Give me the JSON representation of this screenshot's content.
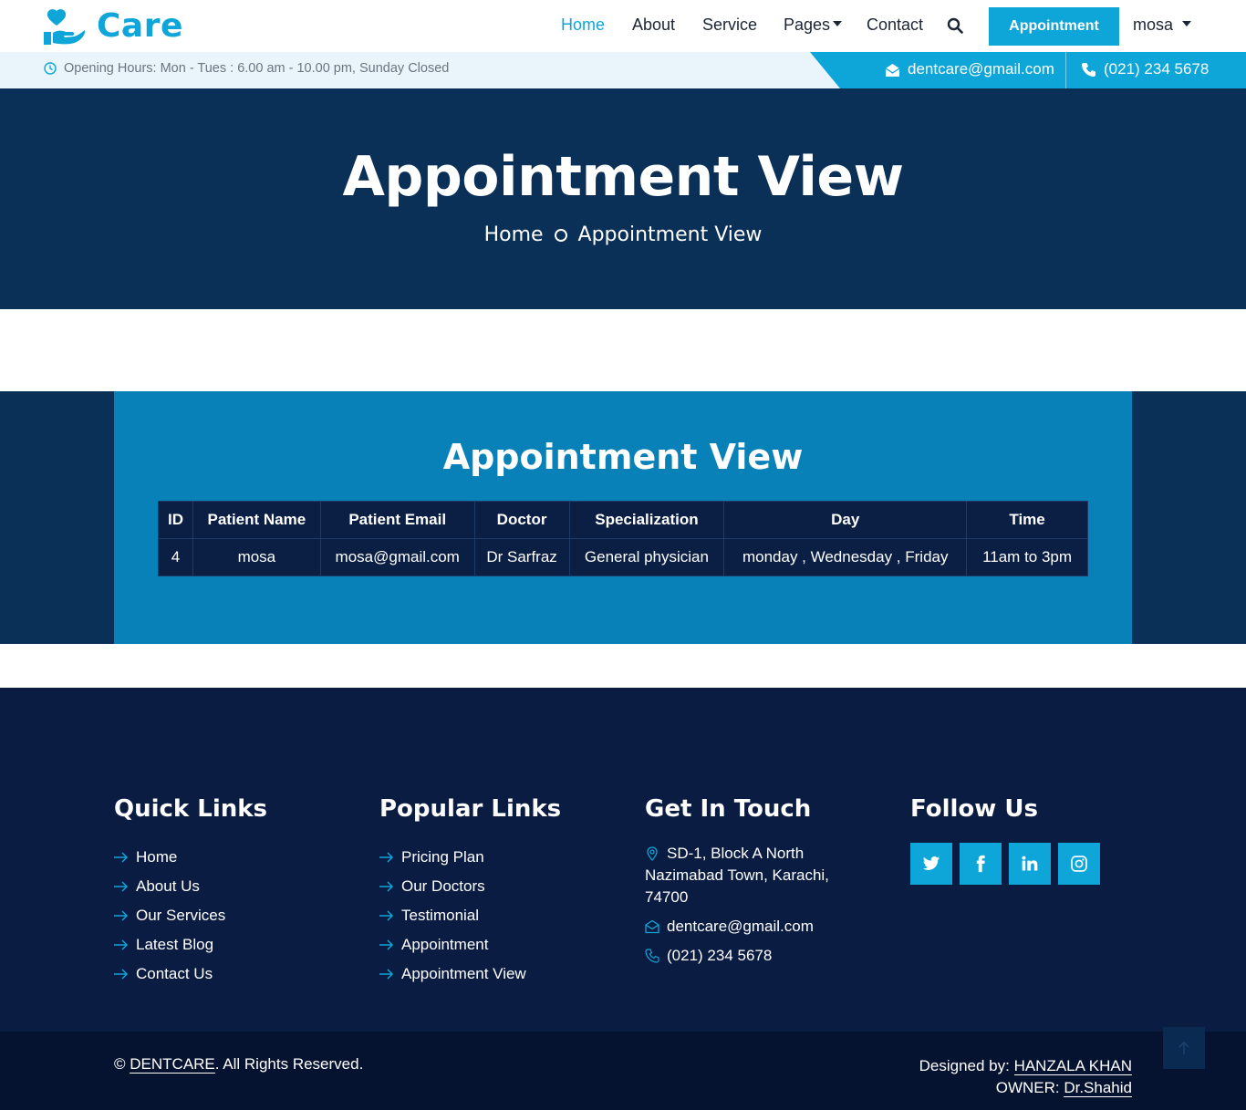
{
  "brand": {
    "name": "Care",
    "color": "#0ea5d9"
  },
  "nav": {
    "items": [
      {
        "label": "Home",
        "active": true
      },
      {
        "label": "About"
      },
      {
        "label": "Service"
      },
      {
        "label": "Pages",
        "dropdown": true
      },
      {
        "label": "Contact"
      }
    ],
    "search_icon": "search-icon",
    "appointment_button": "Appointment",
    "user": "mosa"
  },
  "topbar": {
    "hours": "Opening Hours: Mon - Tues : 6.00 am - 10.00 pm, Sunday Closed",
    "email": "dentcare@gmail.com",
    "phone": "(021) 234 5678"
  },
  "hero": {
    "title": "Appointment View",
    "breadcrumb": [
      "Home",
      "Appointment View"
    ]
  },
  "appointment": {
    "title": "Appointment View",
    "columns": [
      "ID",
      "Patient Name",
      "Patient Email",
      "Doctor",
      "Specialization",
      "Day",
      "Time"
    ],
    "rows": [
      [
        "4",
        "mosa",
        "mosa@gmail.com",
        "Dr Sarfraz",
        "General physician",
        "monday , Wednesday , Friday",
        "11am to 3pm"
      ]
    ]
  },
  "footer": {
    "quick_links": {
      "title": "Quick Links",
      "items": [
        "Home",
        "About Us",
        "Our Services",
        "Latest Blog",
        "Contact Us"
      ]
    },
    "popular_links": {
      "title": "Popular Links",
      "items": [
        "Pricing Plan",
        "Our Doctors",
        "Testimonial",
        "Appointment",
        "Appointment View"
      ]
    },
    "contact": {
      "title": "Get In Touch",
      "address_line1": "SD-1, Block A North",
      "address_line2": "Nazimabad Town, Karachi,",
      "address_line3": "74700",
      "email": "dentcare@gmail.com",
      "phone": "(021) 234 5678"
    },
    "follow": {
      "title": "Follow Us",
      "icons": [
        "twitter-icon",
        "facebook-icon",
        "linkedin-icon",
        "instagram-icon"
      ]
    }
  },
  "bottom": {
    "copyright_symbol": "©",
    "copyright_brand": "DENTCARE",
    "copyright_text": ". All Rights Reserved.",
    "designed_label": "Designed by: ",
    "designer": "HANZALA KHAN",
    "owner_label": "OWNER: ",
    "owner": "Dr.Shahid"
  },
  "colors": {
    "accent": "#0ea5d9",
    "navy": "#0a3057",
    "table_bg": "#0b1f45",
    "footer_bg": "#0b1c43"
  }
}
